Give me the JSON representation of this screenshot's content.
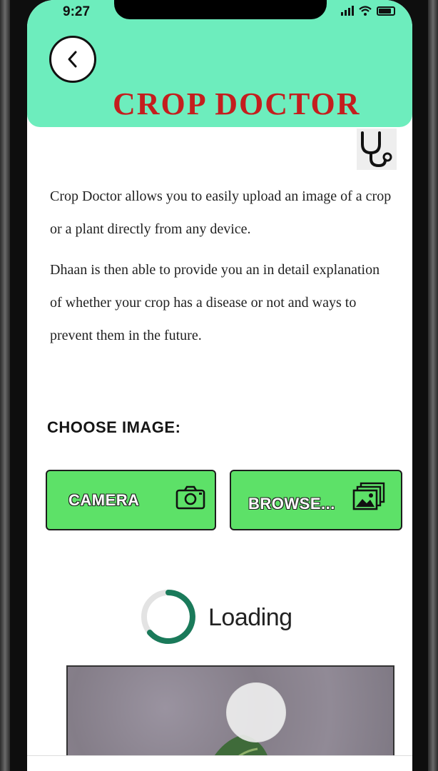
{
  "status_bar": {
    "time": "9:27"
  },
  "header": {
    "title": "CROP DOCTOR",
    "back_icon": "chevron-left-icon",
    "badge_icon": "stethoscope-icon"
  },
  "description": {
    "paragraph1": "Crop Doctor allows you to easily upload an image of a crop or a plant directly from any device.",
    "paragraph2": "Dhaan is then able to provide you an in detail explanation of whether your crop has a disease or not and ways to prevent them in the future."
  },
  "choose_image": {
    "label": "CHOOSE IMAGE:",
    "camera_button": {
      "label": "CAMERA",
      "icon": "camera-icon"
    },
    "browse_button": {
      "label": "BROWSE...",
      "icon": "gallery-icon"
    }
  },
  "loading": {
    "text": "Loading",
    "icon": "spinner-icon"
  },
  "colors": {
    "header_bg": "#6dedbd",
    "title": "#c41e1e",
    "button_bg": "#5de168",
    "spinner": "#1a7a5a"
  }
}
